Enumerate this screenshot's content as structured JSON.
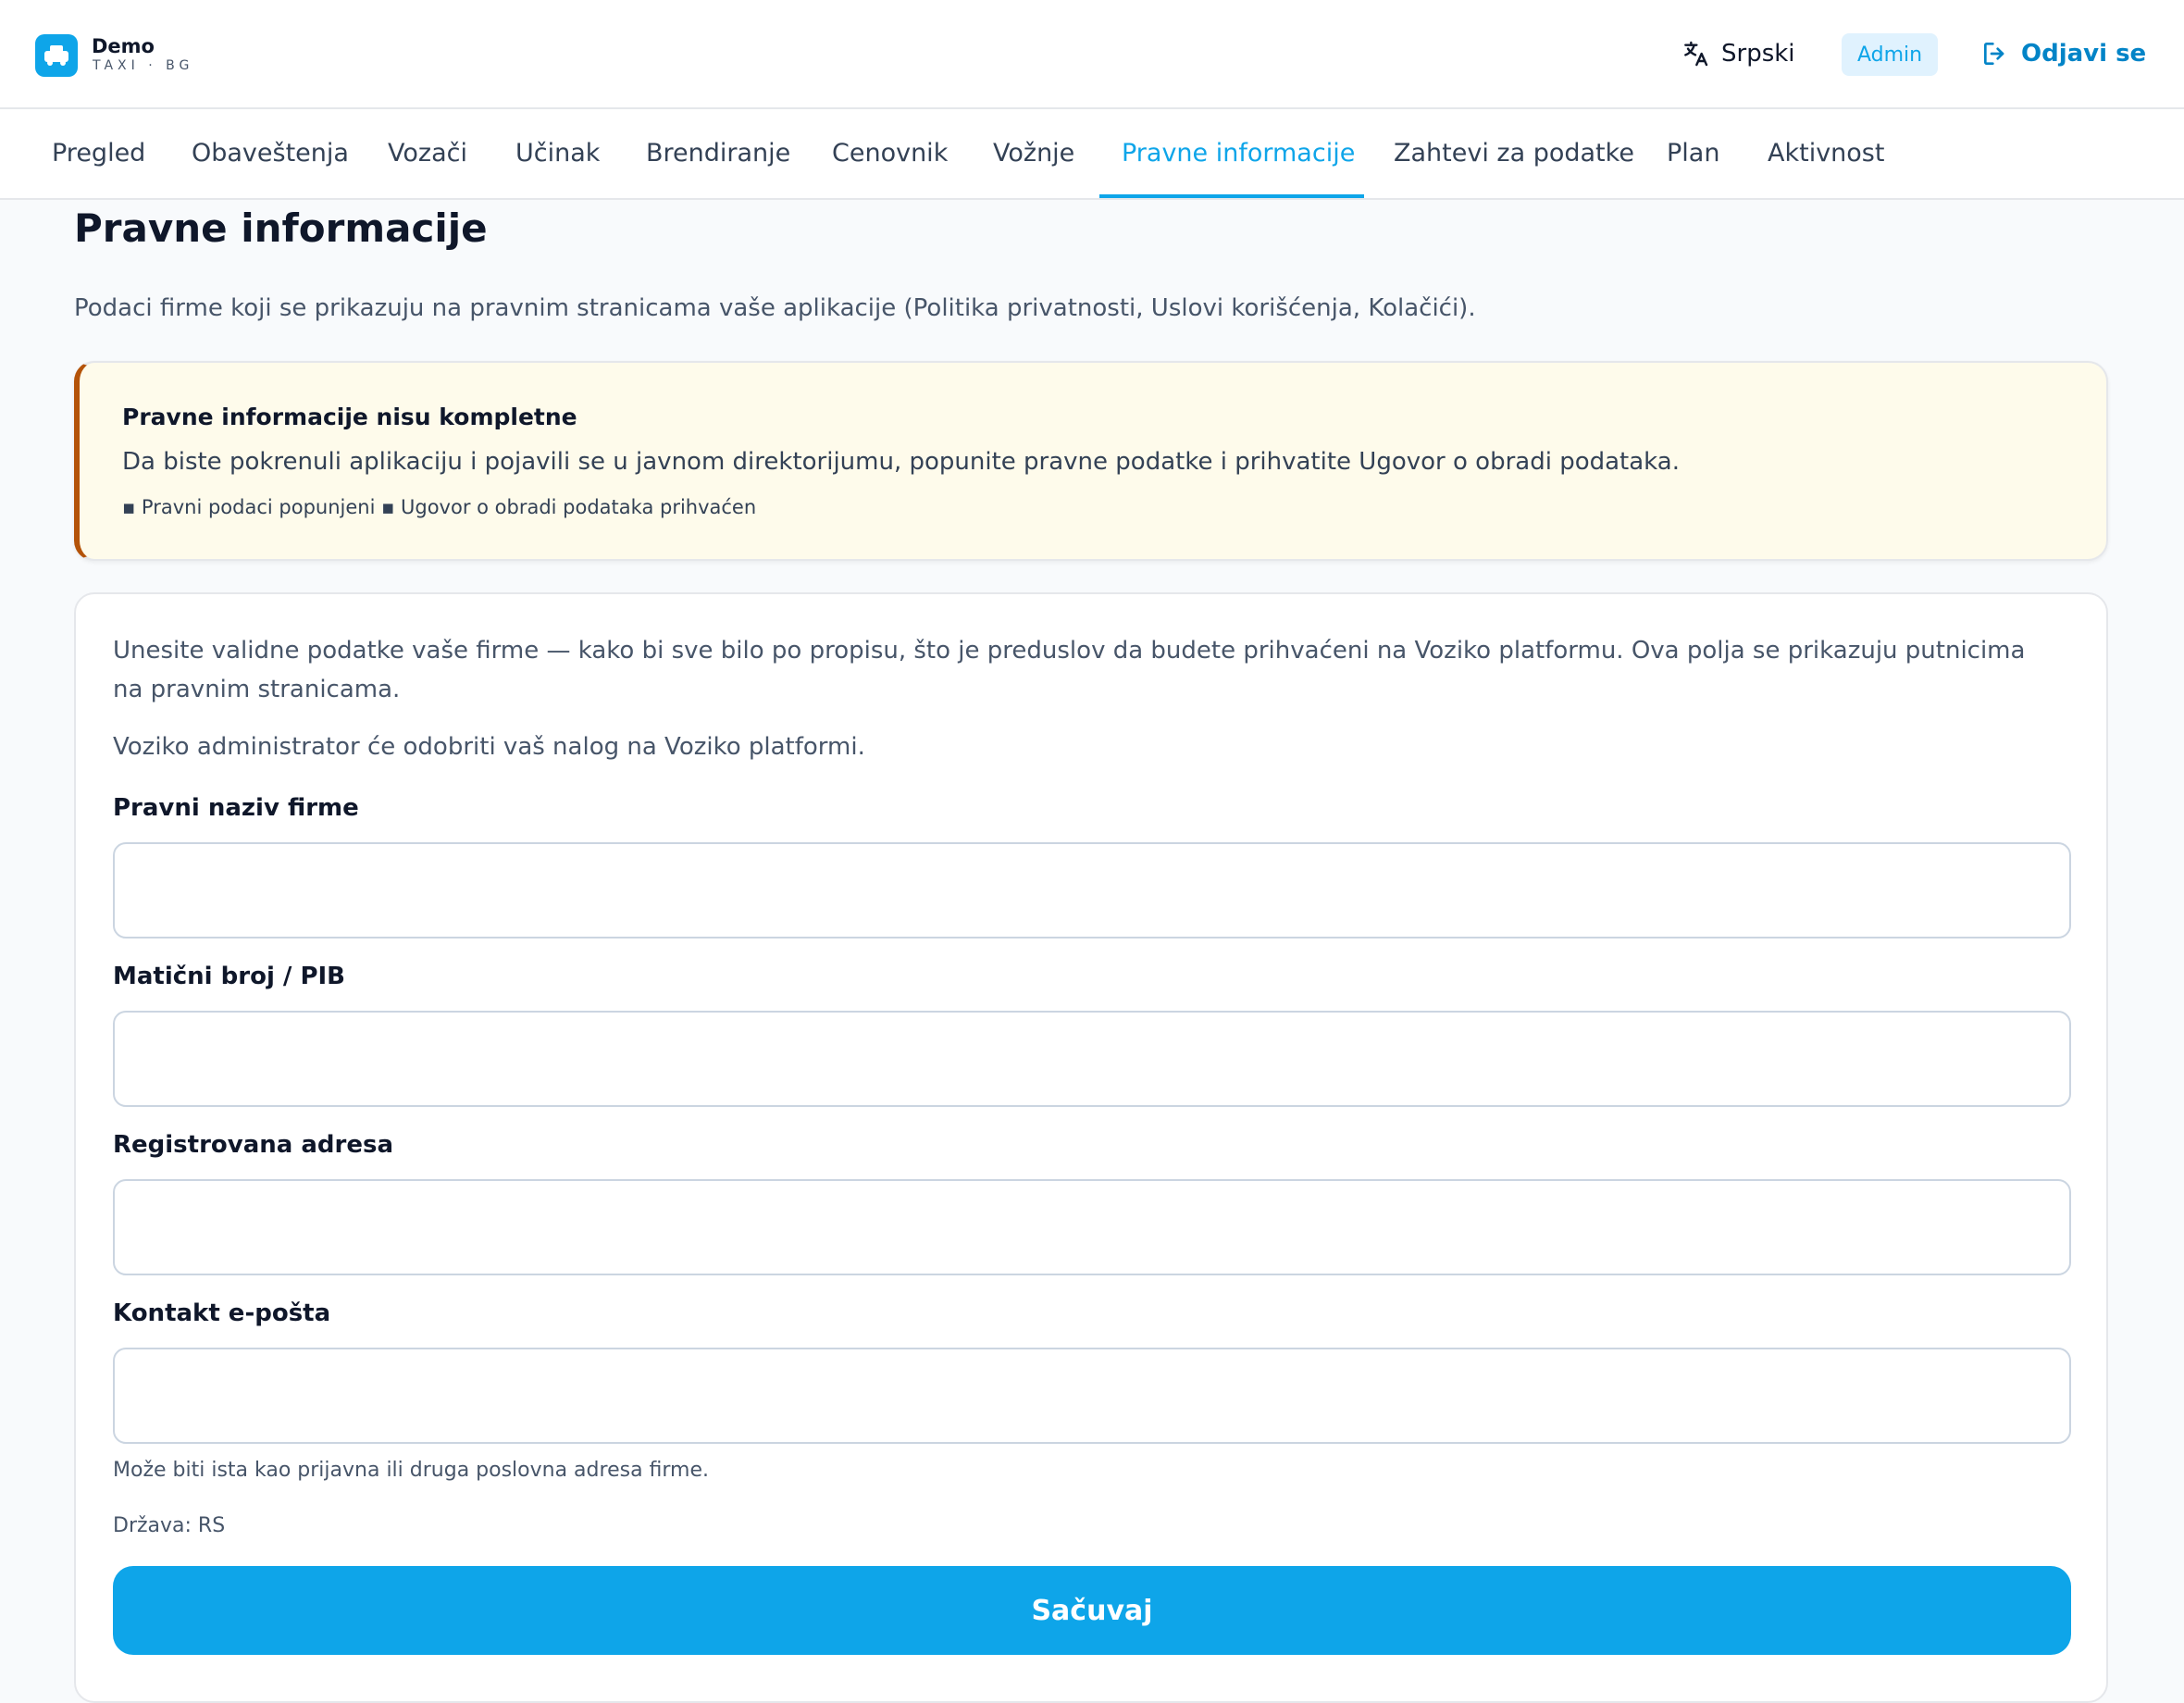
{
  "brand": {
    "name": "Demo",
    "subtitle": "TAXI · BG",
    "icon": "taxi-icon",
    "accent_color": "#0ea5e9"
  },
  "header": {
    "language_label": "Srpski",
    "language_icon": "translate-icon",
    "role_badge": "Admin",
    "logout_label": "Odjavi se",
    "logout_icon": "logout-icon"
  },
  "tabs": [
    {
      "label": "Pregled",
      "active": false
    },
    {
      "label": "Obaveštenja",
      "active": false
    },
    {
      "label": "Vozači",
      "active": false
    },
    {
      "label": "Učinak",
      "active": false
    },
    {
      "label": "Brendiranje",
      "active": false
    },
    {
      "label": "Cenovnik",
      "active": false
    },
    {
      "label": "Vožnje",
      "active": false
    },
    {
      "label": "Pravne informacije",
      "active": true
    },
    {
      "label": "Zahtevi za podatke",
      "active": false
    },
    {
      "label": "Plan",
      "active": false
    },
    {
      "label": "Aktivnost",
      "active": false
    }
  ],
  "page": {
    "title": "Pravne informacije",
    "description": "Podaci firme koji se prikazuju na pravnim stranicama vaše aplikacije (Politika privatnosti, Uslovi korišćenja, Kolačići)."
  },
  "warning": {
    "title": "Pravne informacije nisu kompletne",
    "text": "Da biste pokrenuli aplikaciju i pojavili se u javnom direktorijumu, popunite pravne podatke i prihvatite Ugovor o obradi podataka.",
    "checklist": "▪ Pravni podaci popunjeni ▪ Ugovor o obradi podataka prihvaćen",
    "accent_color": "#b45309"
  },
  "form": {
    "intro": "Unesite validne podatke vaše firme — kako bi sve bilo po propisu, što je preduslov da budete prihvaćeni na Voziko platformu. Ova polja se prikazuju putnicima na pravnim stranicama.",
    "admin_note": "Voziko administrator će odobriti vaš nalog na Voziko platformi.",
    "fields": {
      "legal_name": {
        "label": "Pravni naziv firme",
        "value": "",
        "placeholder": ""
      },
      "registration": {
        "label": "Matični broj / PIB",
        "value": "",
        "placeholder": ""
      },
      "address": {
        "label": "Registrovana adresa",
        "value": "",
        "placeholder": ""
      },
      "email": {
        "label": "Kontakt e-pošta",
        "value": "",
        "placeholder": ""
      }
    },
    "address_hint": "Može biti ista kao prijavna ili druga poslovna adresa firme.",
    "country": "Država: RS",
    "save_label": "Sačuvaj"
  }
}
